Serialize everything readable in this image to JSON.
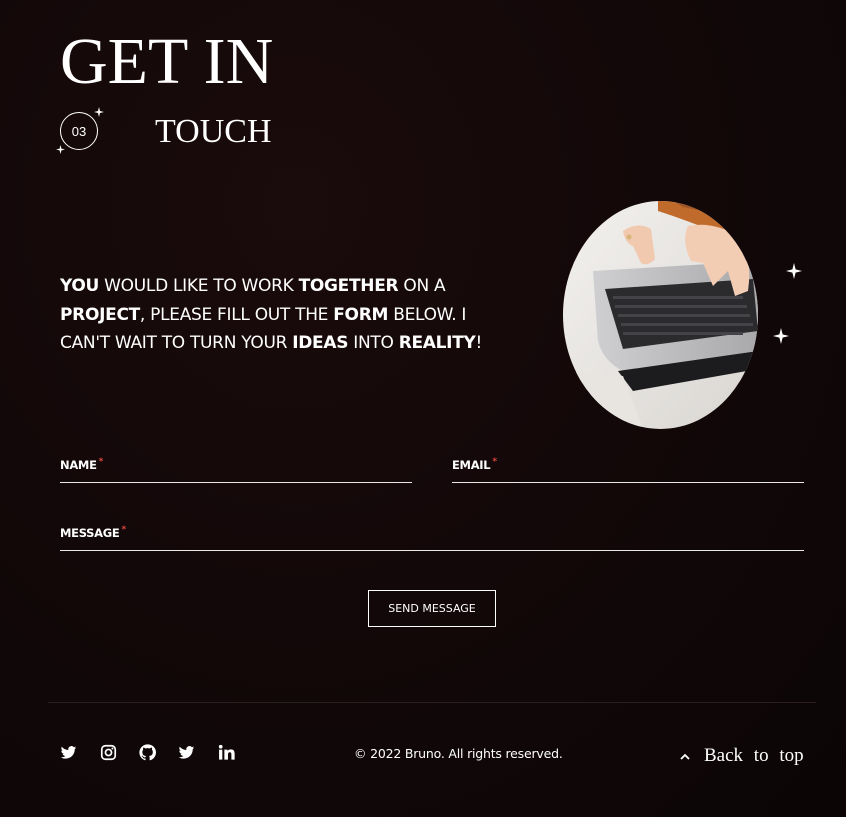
{
  "header": {
    "title_line1": "GET IN",
    "section_number": "03",
    "title_line2": "TOUCH"
  },
  "intro": {
    "segments": [
      {
        "text": "YOU",
        "bold": true
      },
      {
        "text": " WOULD LIKE TO WORK ",
        "bold": false
      },
      {
        "text": "TOGETHER",
        "bold": true
      },
      {
        "text": " ON A ",
        "bold": false
      },
      {
        "text": "PROJECT",
        "bold": true
      },
      {
        "text": ", PLEASE FILL OUT THE ",
        "bold": false
      },
      {
        "text": "FORM",
        "bold": true
      },
      {
        "text": " BELOW. I CAN'T WAIT TO TURN YOUR ",
        "bold": false
      },
      {
        "text": "IDEAS",
        "bold": true
      },
      {
        "text": " INTO ",
        "bold": false
      },
      {
        "text": "REALITY",
        "bold": true
      },
      {
        "text": "!",
        "bold": false
      }
    ]
  },
  "form": {
    "name_label": "NAME",
    "email_label": "EMAIL",
    "message_label": "MESSAGE",
    "required_mark": "*",
    "name_value": "",
    "email_value": "",
    "message_value": "",
    "submit_label": "SEND MESSAGE"
  },
  "footer": {
    "social_icons": [
      "twitter-icon",
      "instagram-icon",
      "github-icon",
      "twitter-icon",
      "linkedin-icon"
    ],
    "copyright": "© 2022 Bruno. All rights reserved.",
    "back_to_top_label": "Back to top"
  },
  "colors": {
    "background": "#130809",
    "text": "#ffffff",
    "required": "#e0473b",
    "accent_sweater": "#c06a2c"
  }
}
